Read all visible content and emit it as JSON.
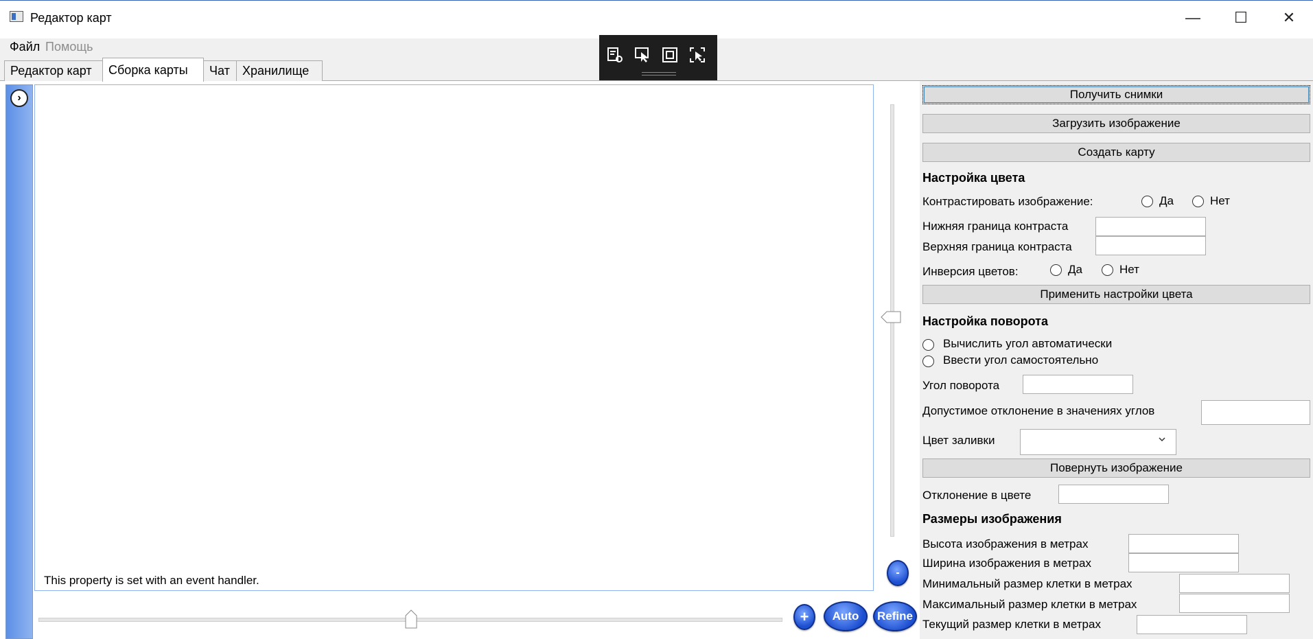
{
  "window": {
    "title": "Редактор карт",
    "controls": {
      "minimize": "—",
      "maximize": "☐",
      "close": "✕"
    }
  },
  "menu": [
    "Файл",
    "Помощь"
  ],
  "tabs": [
    {
      "label": "Редактор карт",
      "active": false
    },
    {
      "label": "Сборка карты",
      "active": true
    },
    {
      "label": "Чат",
      "active": false
    },
    {
      "label": "Хранилище",
      "active": false
    }
  ],
  "debug_toolbar": {
    "icons": [
      "inspect-tree-icon",
      "select-element-icon",
      "layout-bounds-icon",
      "track-focus-icon"
    ]
  },
  "canvas": {
    "status_text": "This property is set with an event handler.",
    "expand_icon": "›"
  },
  "zoom": {
    "out_label": "-",
    "in_label": "+",
    "auto_label": "Auto",
    "refine_label": "Refine"
  },
  "right_panel": {
    "get_images": "Получить снимки",
    "load_image": "Загрузить изображение",
    "create_map": "Создать карту",
    "color": {
      "title": "Настройка цвета",
      "contrast_label": "Контрастировать изображение:",
      "yes": "Да",
      "no": "Нет",
      "lower_label": "Нижняя граница контраста",
      "upper_label": "Верхняя граница контраста",
      "inversion_label": "Инверсия цветов:",
      "apply": "Применить настройки цвета"
    },
    "rotation": {
      "title": "Настройка поворота",
      "auto_option": "Вычислить угол автоматически",
      "manual_option": "Ввести угол самостоятельно",
      "angle_label": "Угол поворота",
      "tolerance_label": "Допустимое отклонение в значениях углов",
      "fill_label": "Цвет заливки",
      "fill_value": "",
      "rotate": "Повернуть изображение",
      "color_dev_label": "Отклонение в цвете"
    },
    "size": {
      "title": "Размеры изображения",
      "height_label": "Высота изображения в метрах",
      "width_label": "Ширина изображения в метрах",
      "min_cell_label": "Минимальный размер клетки в метрах",
      "max_cell_label": "Максимальный размер клетки в метрах",
      "cur_cell_label": "Текущий размер клетки в метрах"
    }
  }
}
